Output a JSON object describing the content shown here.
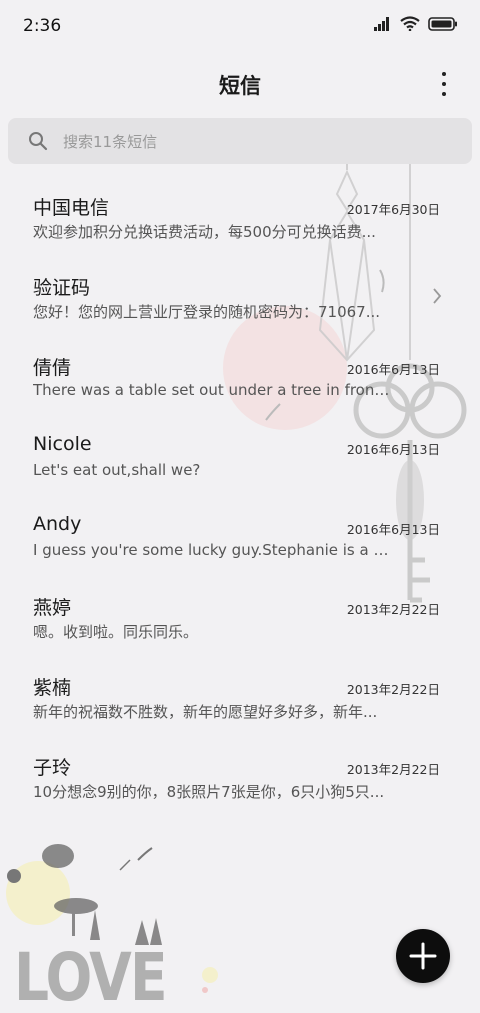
{
  "status_bar": {
    "time": "2:36",
    "icons": [
      "signal-icon",
      "wifi-icon",
      "battery-icon"
    ]
  },
  "header": {
    "title": "短信",
    "menu_icon": "more-vertical-icon"
  },
  "search": {
    "placeholder": "搜索11条短信",
    "icon": "search-icon"
  },
  "messages": [
    {
      "name": "中国电信",
      "date": "2017年6月30日",
      "preview": "欢迎参加积分兑换话费活动，每500分可兑换话费..."
    },
    {
      "name": "验证码",
      "date": "",
      "preview": "您好！您的网上营业厅登录的随机密码为：71067..."
    },
    {
      "name": "倩倩",
      "date": "2016年6月13日",
      "preview": "There was a table set out under a tree in front o..."
    },
    {
      "name": "Nicole",
      "date": "2016年6月13日",
      "preview": "Let's eat out,shall we?"
    },
    {
      "name": "Andy",
      "date": "2016年6月13日",
      "preview": "I guess you're some lucky guy.Stephanie is a n..."
    },
    {
      "name": "燕婷",
      "date": "2013年2月22日",
      "preview": "嗯。收到啦。同乐同乐。"
    },
    {
      "name": "紫楠",
      "date": "2013年2月22日",
      "preview": "新年的祝福数不胜数，新年的愿望好多好多，新年..."
    },
    {
      "name": "子玲",
      "date": "2013年2月22日",
      "preview": "10分想念9别的你，8张照片7张是你，6只小狗5只..."
    }
  ],
  "wallpaper": {
    "text": "LOVE"
  },
  "fab": {
    "icon": "plus-icon"
  }
}
